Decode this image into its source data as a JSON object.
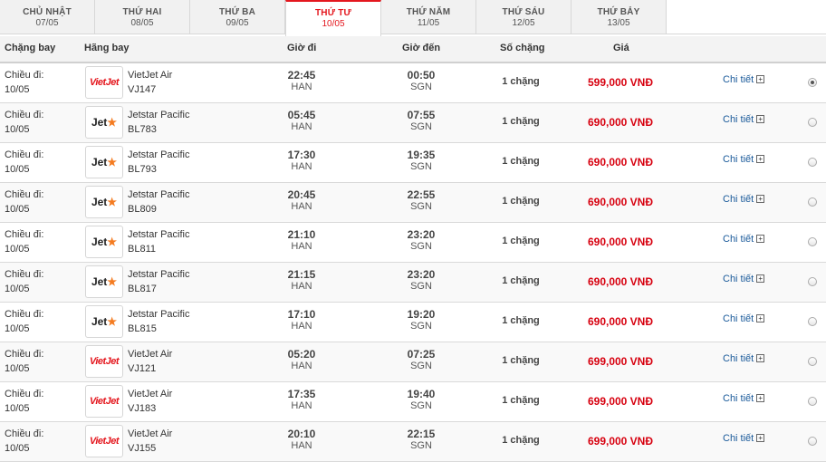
{
  "tabs": [
    {
      "day": "CHỦ NHẬT",
      "date": "07/05",
      "active": false
    },
    {
      "day": "THỨ HAI",
      "date": "08/05",
      "active": false
    },
    {
      "day": "THỨ BA",
      "date": "09/05",
      "active": false
    },
    {
      "day": "THỨ TƯ",
      "date": "10/05",
      "active": true
    },
    {
      "day": "THỨ NĂM",
      "date": "11/05",
      "active": false
    },
    {
      "day": "THỨ SÁU",
      "date": "12/05",
      "active": false
    },
    {
      "day": "THỨ BẢY",
      "date": "13/05",
      "active": false
    }
  ],
  "header": {
    "route": "Chặng bay",
    "airline": "Hãng bay",
    "depart": "Giờ đi",
    "arrive": "Giờ đến",
    "stops": "Số chặng",
    "price": "Giá"
  },
  "colors": {
    "accent": "#e4171e",
    "price": "#d7000f",
    "link": "#1a5a9a",
    "jetstar_star": "#f47b20"
  },
  "flights": [
    {
      "route_label": "Chiều đi:",
      "date": "10/05",
      "logo": "vietjet-logo",
      "logo_text": "VietJet",
      "airline": "VietJet Air",
      "code": "VJ147",
      "dep_time": "22:45",
      "dep_code": "HAN",
      "arr_time": "00:50",
      "arr_code": "SGN",
      "stops": "1 chặng",
      "price": "599,000 VNĐ",
      "detail": "Chi tiết",
      "selected": true
    },
    {
      "route_label": "Chiều đi:",
      "date": "10/05",
      "logo": "jetstar-logo",
      "logo_text": "Jet",
      "airline": "Jetstar Pacific",
      "code": "BL783",
      "dep_time": "05:45",
      "dep_code": "HAN",
      "arr_time": "07:55",
      "arr_code": "SGN",
      "stops": "1 chặng",
      "price": "690,000 VNĐ",
      "detail": "Chi tiết",
      "selected": false
    },
    {
      "route_label": "Chiều đi:",
      "date": "10/05",
      "logo": "jetstar-logo",
      "logo_text": "Jet",
      "airline": "Jetstar Pacific",
      "code": "BL793",
      "dep_time": "17:30",
      "dep_code": "HAN",
      "arr_time": "19:35",
      "arr_code": "SGN",
      "stops": "1 chặng",
      "price": "690,000 VNĐ",
      "detail": "Chi tiết",
      "selected": false
    },
    {
      "route_label": "Chiều đi:",
      "date": "10/05",
      "logo": "jetstar-logo",
      "logo_text": "Jet",
      "airline": "Jetstar Pacific",
      "code": "BL809",
      "dep_time": "20:45",
      "dep_code": "HAN",
      "arr_time": "22:55",
      "arr_code": "SGN",
      "stops": "1 chặng",
      "price": "690,000 VNĐ",
      "detail": "Chi tiết",
      "selected": false
    },
    {
      "route_label": "Chiều đi:",
      "date": "10/05",
      "logo": "jetstar-logo",
      "logo_text": "Jet",
      "airline": "Jetstar Pacific",
      "code": "BL811",
      "dep_time": "21:10",
      "dep_code": "HAN",
      "arr_time": "23:20",
      "arr_code": "SGN",
      "stops": "1 chặng",
      "price": "690,000 VNĐ",
      "detail": "Chi tiết",
      "selected": false
    },
    {
      "route_label": "Chiều đi:",
      "date": "10/05",
      "logo": "jetstar-logo",
      "logo_text": "Jet",
      "airline": "Jetstar Pacific",
      "code": "BL817",
      "dep_time": "21:15",
      "dep_code": "HAN",
      "arr_time": "23:20",
      "arr_code": "SGN",
      "stops": "1 chặng",
      "price": "690,000 VNĐ",
      "detail": "Chi tiết",
      "selected": false
    },
    {
      "route_label": "Chiều đi:",
      "date": "10/05",
      "logo": "jetstar-logo",
      "logo_text": "Jet",
      "airline": "Jetstar Pacific",
      "code": "BL815",
      "dep_time": "17:10",
      "dep_code": "HAN",
      "arr_time": "19:20",
      "arr_code": "SGN",
      "stops": "1 chặng",
      "price": "690,000 VNĐ",
      "detail": "Chi tiết",
      "selected": false
    },
    {
      "route_label": "Chiều đi:",
      "date": "10/05",
      "logo": "vietjet-logo",
      "logo_text": "VietJet",
      "airline": "VietJet Air",
      "code": "VJ121",
      "dep_time": "05:20",
      "dep_code": "HAN",
      "arr_time": "07:25",
      "arr_code": "SGN",
      "stops": "1 chặng",
      "price": "699,000 VNĐ",
      "detail": "Chi tiết",
      "selected": false
    },
    {
      "route_label": "Chiều đi:",
      "date": "10/05",
      "logo": "vietjet-logo",
      "logo_text": "VietJet",
      "airline": "VietJet Air",
      "code": "VJ183",
      "dep_time": "17:35",
      "dep_code": "HAN",
      "arr_time": "19:40",
      "arr_code": "SGN",
      "stops": "1 chặng",
      "price": "699,000 VNĐ",
      "detail": "Chi tiết",
      "selected": false
    },
    {
      "route_label": "Chiều đi:",
      "date": "10/05",
      "logo": "vietjet-logo",
      "logo_text": "VietJet",
      "airline": "VietJet Air",
      "code": "VJ155",
      "dep_time": "20:10",
      "dep_code": "HAN",
      "arr_time": "22:15",
      "arr_code": "SGN",
      "stops": "1 chặng",
      "price": "699,000 VNĐ",
      "detail": "Chi tiết",
      "selected": false
    }
  ]
}
